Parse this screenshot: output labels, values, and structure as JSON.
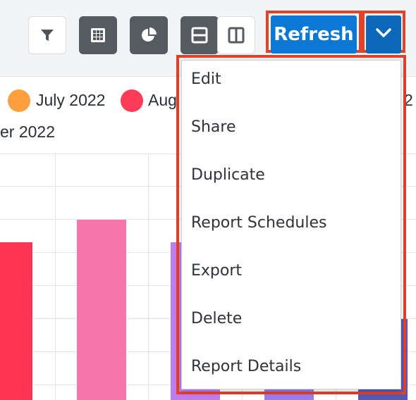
{
  "toolbar": {
    "buttons": [
      {
        "icon": "filter-icon"
      },
      {
        "icon": "grid-icon"
      },
      {
        "icon": "pie-chart-icon"
      },
      {
        "icon": "split-horizontal-icon"
      },
      {
        "icon": "split-vertical-icon"
      }
    ],
    "refresh_label": "Refresh",
    "dropdown_icon": "chevron-down-icon",
    "colors": {
      "refresh": "#0b78d3",
      "dropdown": "#0b67b8",
      "highlight": "#e2422a",
      "dark_button": "#565b62"
    }
  },
  "legend": {
    "items": [
      {
        "label": "July 2022",
        "color": "#ff9f40"
      },
      {
        "label": "Aug",
        "color": "#ff3b57"
      },
      {
        "label": "2"
      },
      {
        "label": "er 2022"
      }
    ]
  },
  "chart": {
    "bar_colors": [
      "#ff3553",
      "#f575ad",
      "#c07df0",
      "#9a7cf0",
      "#5459b8"
    ]
  },
  "menu": {
    "items": [
      "Edit",
      "Share",
      "Duplicate",
      "Report Schedules",
      "Export",
      "Delete",
      "Report Details"
    ]
  }
}
